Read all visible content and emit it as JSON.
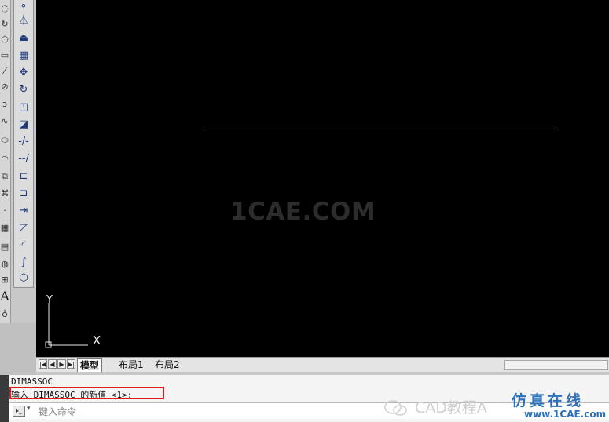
{
  "toolbar_left": {
    "draw_icons": [
      "arc-icon",
      "polygon-icon",
      "rectangle-icon",
      "line-icon",
      "circle-icon",
      "revision-cloud-icon",
      "spline-icon",
      "ellipse-icon",
      "ellipse-arc-icon",
      "insert-block-icon",
      "make-block-icon",
      "point-icon",
      "hatch-icon",
      "gradient-icon",
      "region-icon",
      "table-icon",
      "multiline-text-icon",
      "add-selected-icon"
    ],
    "modify_icons": [
      "copy-icon",
      "mirror-icon",
      "offset-icon",
      "array-icon",
      "move-icon",
      "rotate-icon",
      "scale-icon",
      "stretch-icon",
      "trim-icon",
      "extend-icon",
      "break-at-point-icon",
      "break-icon",
      "join-icon",
      "chamfer-icon",
      "fillet-icon",
      "blend-curves-icon",
      "explode-icon"
    ]
  },
  "canvas": {
    "watermark": "1CAE.COM",
    "ucs": {
      "x_label": "X",
      "y_label": "Y"
    }
  },
  "layout_tabs": {
    "tabs": [
      "模型",
      "布局1",
      "布局2"
    ]
  },
  "command": {
    "history_line": "DIMASSOC",
    "prompt_line": "输入 DIMASSOC 的新值 <1>:",
    "input_placeholder": "键入命令"
  },
  "branding": {
    "wechat_label": "CAD教程A",
    "site_name": "仿真在线",
    "site_url": "www.1CAE.com"
  }
}
